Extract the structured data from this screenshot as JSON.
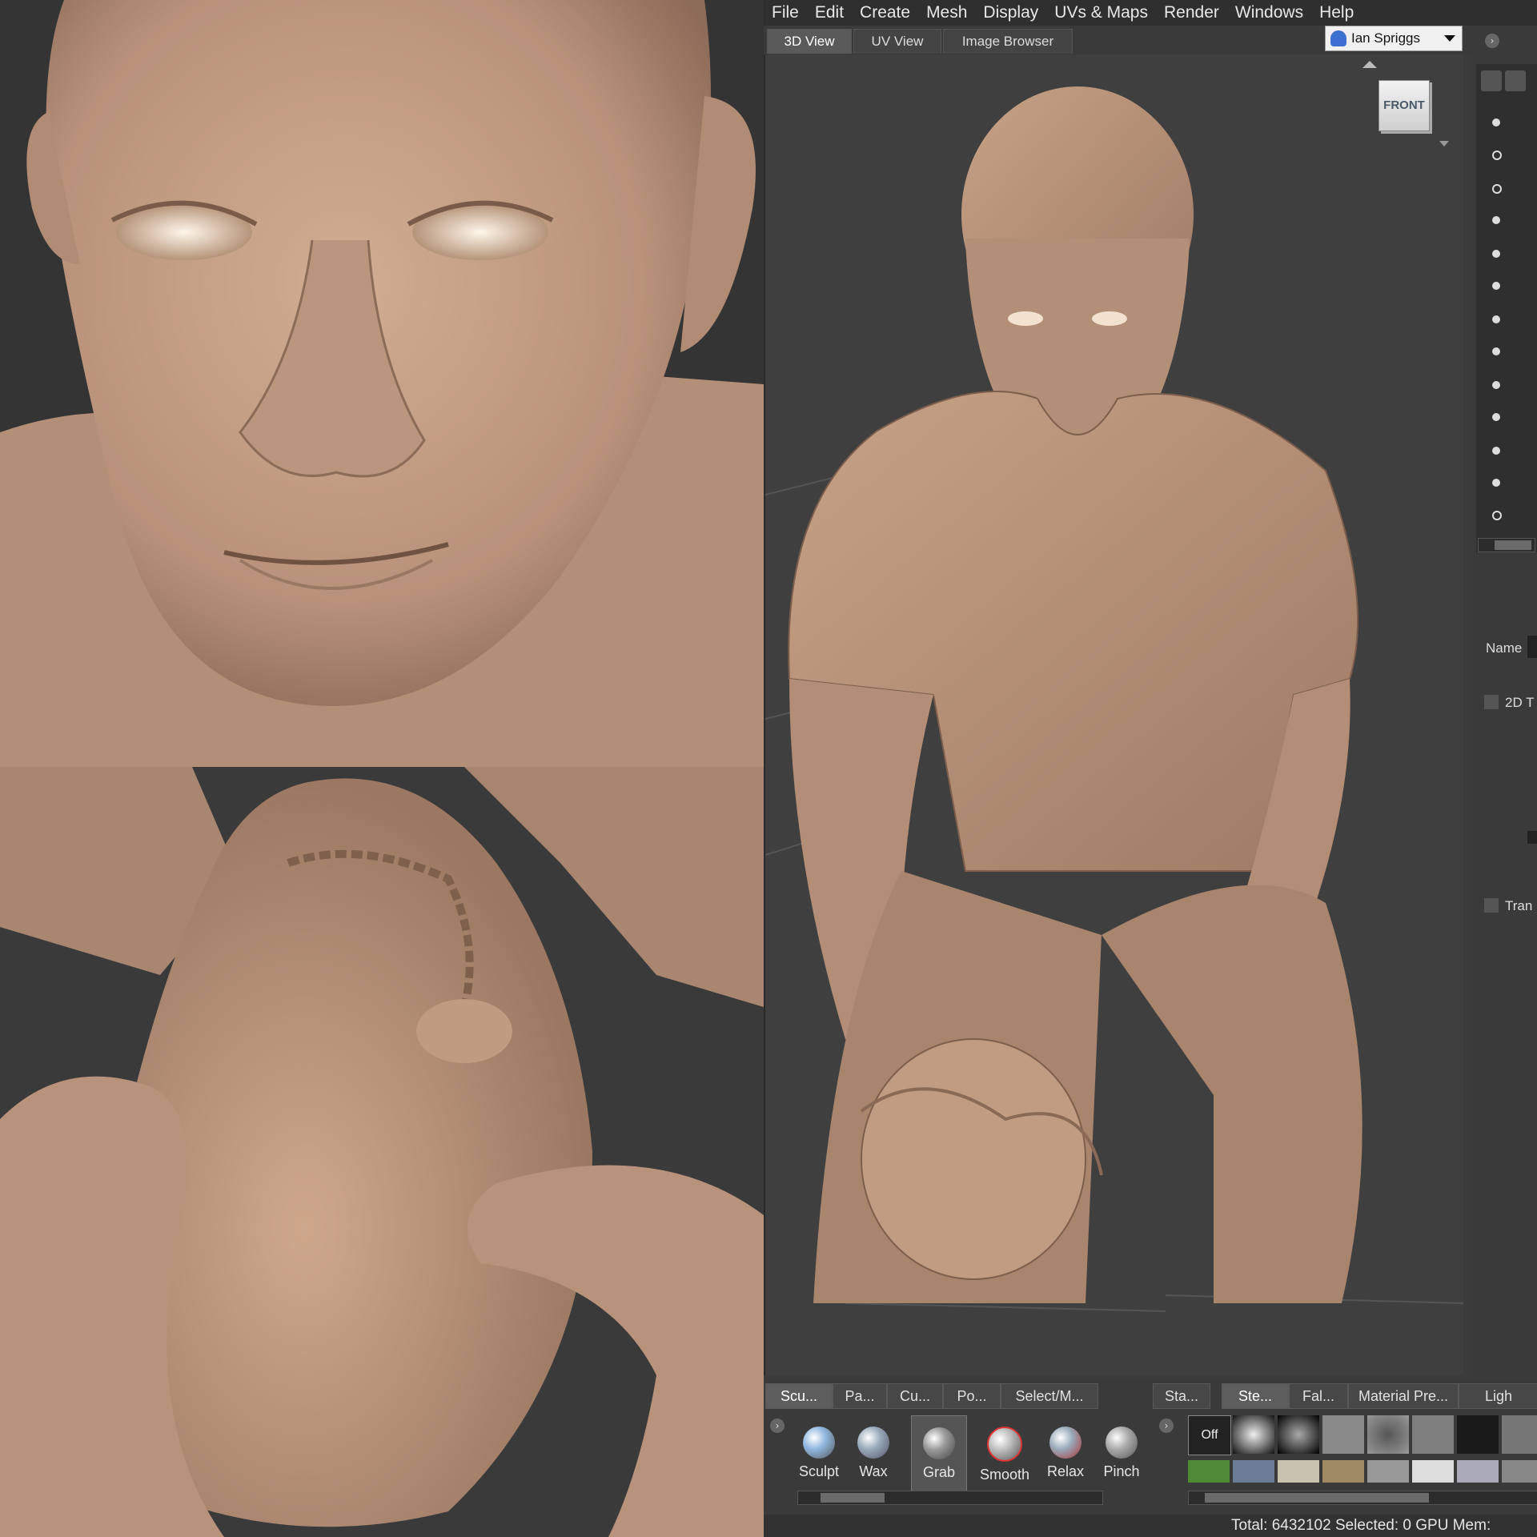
{
  "menu": [
    "File",
    "Edit",
    "Create",
    "Mesh",
    "Display",
    "UVs & Maps",
    "Render",
    "Windows",
    "Help"
  ],
  "view_tabs": [
    "3D View",
    "UV View",
    "Image Browser"
  ],
  "user": {
    "name": "Ian Spriggs",
    "icon": "user-icon"
  },
  "viewcube_label": "FRONT",
  "right_panel": {
    "name_label": "Name",
    "section_2d": "2D T",
    "section_transform": "Tran"
  },
  "tray_tabs_left": [
    "Scu...",
    "Pa...",
    "Cu...",
    "Po...",
    "Select/M..."
  ],
  "tray_tabs_right": [
    "Sta...",
    "Ste...",
    "Fal...",
    "Material Pre...",
    "Ligh"
  ],
  "tools": [
    {
      "label": "Sculpt",
      "icon": "sculpt-brush-icon",
      "active": false
    },
    {
      "label": "Wax",
      "icon": "wax-brush-icon",
      "active": false
    },
    {
      "label": "Grab",
      "icon": "grab-brush-icon",
      "active": true
    },
    {
      "label": "Smooth",
      "icon": "smooth-brush-icon",
      "active": false
    },
    {
      "label": "Relax",
      "icon": "relax-brush-icon",
      "active": false
    },
    {
      "label": "Pinch",
      "icon": "pinch-brush-icon",
      "active": false
    }
  ],
  "stamp_off_label": "Off",
  "status": "Total: 6432102  Selected: 0 GPU Mem: ",
  "colors": {
    "skin": "#c49f84",
    "background": "#333333",
    "ui_dark": "#3a3a3a"
  }
}
